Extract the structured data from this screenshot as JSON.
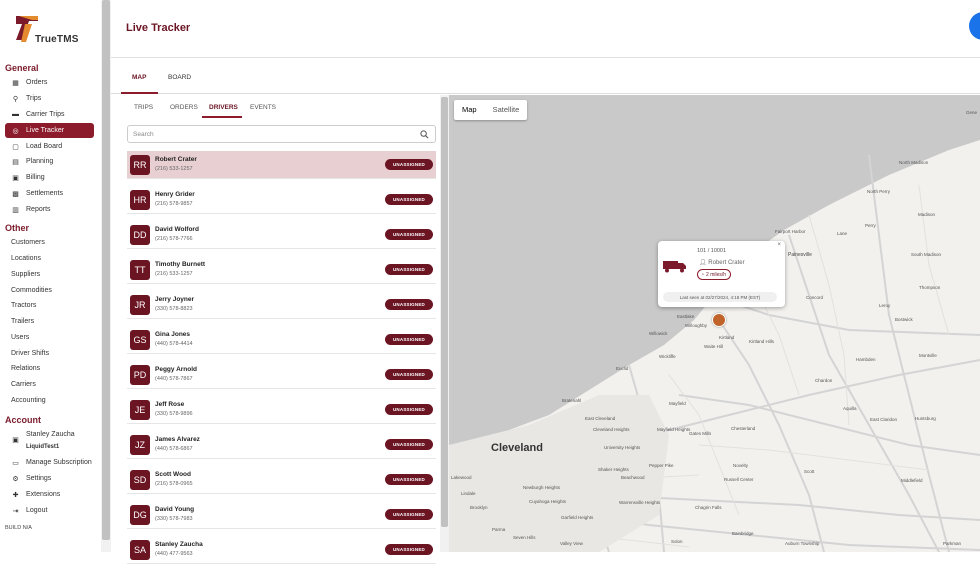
{
  "brand": {
    "name": "TrueTMS",
    "accent": "#8c1c2c"
  },
  "sidebar": {
    "general_title": "General",
    "general": [
      {
        "label": "Orders",
        "icon": "box-icon"
      },
      {
        "label": "Trips",
        "icon": "route-icon"
      },
      {
        "label": "Carrier Trips",
        "icon": "truck-icon"
      },
      {
        "label": "Live Tracker",
        "icon": "location-icon",
        "active": true
      },
      {
        "label": "Load Board",
        "icon": "clipboard-icon"
      },
      {
        "label": "Planning",
        "icon": "calendar-icon"
      },
      {
        "label": "Billing",
        "icon": "invoice-icon"
      },
      {
        "label": "Settlements",
        "icon": "money-icon"
      },
      {
        "label": "Reports",
        "icon": "report-icon"
      }
    ],
    "other_title": "Other",
    "other": [
      "Customers",
      "Locations",
      "Suppliers",
      "Commodities",
      "Tractors",
      "Trailers",
      "Users",
      "Driver Shifts",
      "Relations",
      "Carriers",
      "Accounting"
    ],
    "account_title": "Account",
    "account": {
      "user_name": "Stanley Zaucha",
      "org": "LiquidTest1",
      "items": [
        {
          "label": "Manage Subscription",
          "icon": "card-icon"
        },
        {
          "label": "Settings",
          "icon": "gear-icon"
        },
        {
          "label": "Extensions",
          "icon": "puzzle-icon"
        },
        {
          "label": "Logout",
          "icon": "logout-icon"
        }
      ]
    },
    "build": "BUILD N/A"
  },
  "header": {
    "title": "Live Tracker"
  },
  "main_tabs": [
    "MAP",
    "BOARD"
  ],
  "sub_tabs": [
    "TRIPS",
    "ORDERS",
    "DRIVERS",
    "EVENTS"
  ],
  "search": {
    "placeholder": "Search",
    "value": ""
  },
  "drivers": [
    {
      "initials": "RR",
      "name": "Robert Crater",
      "phone": "(216) 533-1257",
      "status": "UNASSIGNED"
    },
    {
      "initials": "HR",
      "name": "Henry Grider",
      "phone": "(216) 578-9857",
      "status": "UNASSIGNED"
    },
    {
      "initials": "DD",
      "name": "David Wolford",
      "phone": "(216) 578-7766",
      "status": "UNASSIGNED"
    },
    {
      "initials": "TT",
      "name": "Timothy Burnett",
      "phone": "(216) 533-1257",
      "status": "UNASSIGNED"
    },
    {
      "initials": "JR",
      "name": "Jerry Joyner",
      "phone": "(330) 578-8823",
      "status": "UNASSIGNED"
    },
    {
      "initials": "GS",
      "name": "Gina Jones",
      "phone": "(440) 578-4414",
      "status": "UNASSIGNED"
    },
    {
      "initials": "PD",
      "name": "Peggy Arnold",
      "phone": "(440) 578-7867",
      "status": "UNASSIGNED"
    },
    {
      "initials": "JE",
      "name": "Jeff Rose",
      "phone": "(330) 578-9896",
      "status": "UNASSIGNED"
    },
    {
      "initials": "JZ",
      "name": "James Alvarez",
      "phone": "(440) 578-6867",
      "status": "UNASSIGNED"
    },
    {
      "initials": "SD",
      "name": "Scott Wood",
      "phone": "(216) 578-0965",
      "status": "UNASSIGNED"
    },
    {
      "initials": "DG",
      "name": "David Young",
      "phone": "(330) 578-7983",
      "status": "UNASSIGNED"
    },
    {
      "initials": "SA",
      "name": "Stanley Zaucha",
      "phone": "(440) 477-9563",
      "status": "UNASSIGNED"
    }
  ],
  "map": {
    "toggle": [
      "Map",
      "Satellite"
    ],
    "popup": {
      "unit": "101 / 10001",
      "driver": "Robert Crater",
      "speed": "2 miles/h",
      "last_seen": "Last seen at 02/27/2024, 4:18 PM (EST)",
      "close": "×"
    },
    "labels": {
      "cleveland": "Cleveland",
      "geneva": "Gene",
      "north_madison": "North Madison",
      "north_perry": "North Perry",
      "madison": "Madison",
      "perry": "Perry",
      "fairport": "Fairport Harbor",
      "lane": "Lane",
      "south_madison": "South Madison",
      "painesville": "Painesville",
      "thompson": "Thompson",
      "mentor": "Mentor",
      "concord": "Concord",
      "leroy": "Leroy",
      "eastlake": "Eastlake",
      "willowick": "Willowick",
      "willoughby": "Willoughby",
      "kirtland": "Kirtland",
      "kirtland_hills": "Kirtland Hills",
      "waite_hill": "Waite Hill",
      "wickliffe": "Wickliffe",
      "euclid": "Euclid",
      "montville": "Montville",
      "bostwick": "Bostwick",
      "hambden": "Hambden",
      "chardon": "Chardon",
      "mayfield": "Mayfield",
      "gates_mills": "Gates Mills",
      "chesterland": "Chesterland",
      "aquilla": "Aquilla",
      "east_claridon": "East Claridon",
      "huntsburg": "Huntsburg",
      "east_cleveland": "East Cleveland",
      "cleveland_heights": "Cleveland Heights",
      "university_heights": "University Heights",
      "mayfield_heights": "Mayfield Heights",
      "shaker_heights": "Shaker Heights",
      "pepper_pike": "Pepper Pike",
      "beachwood": "Beachwood",
      "scott": "Scott",
      "russell_center": "Russell Center",
      "middlefield": "Middlefield",
      "novelty": "Novelty",
      "warrensville": "Warrensville Heights",
      "chagrin_falls": "Chagrin Falls",
      "bainbridge": "Bainbridge",
      "auburn": "Auburn Township",
      "parkman": "Parkman",
      "newburgh": "Newburgh Heights",
      "cuyahoga": "Cuyahoga Heights",
      "garfield": "Garfield Heights",
      "bratenahl": "Bratenahl",
      "lindale": "Lindale",
      "brooklyn": "Brooklyn",
      "parma": "Parma",
      "seven_hills": "Seven Hills",
      "valley_view": "Valley View",
      "solon": "Solon",
      "lakewood": "Lakewood"
    }
  }
}
